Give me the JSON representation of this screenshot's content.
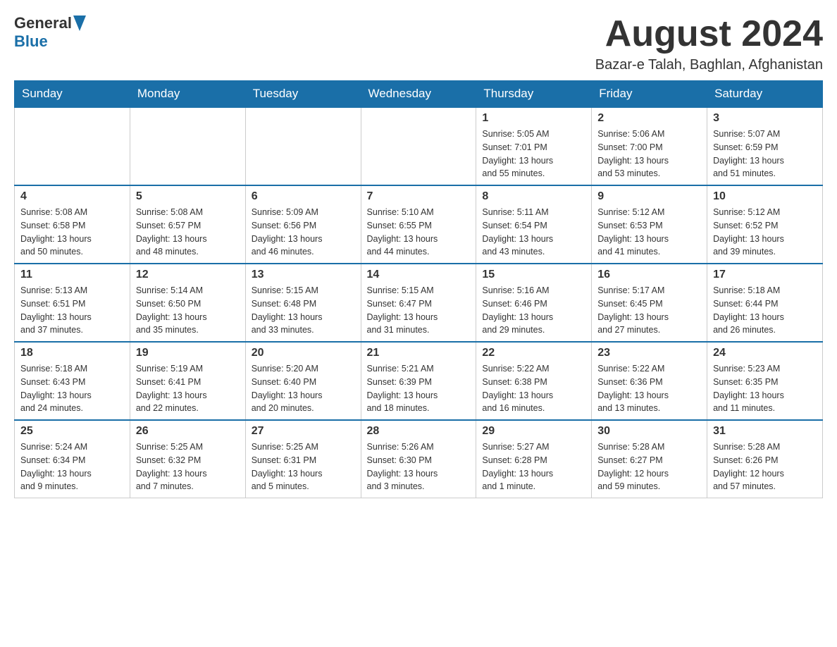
{
  "header": {
    "logo_general": "General",
    "logo_blue": "Blue",
    "month_title": "August 2024",
    "location": "Bazar-e Talah, Baghlan, Afghanistan"
  },
  "days_of_week": [
    "Sunday",
    "Monday",
    "Tuesday",
    "Wednesday",
    "Thursday",
    "Friday",
    "Saturday"
  ],
  "weeks": [
    [
      {
        "day": "",
        "info": ""
      },
      {
        "day": "",
        "info": ""
      },
      {
        "day": "",
        "info": ""
      },
      {
        "day": "",
        "info": ""
      },
      {
        "day": "1",
        "info": "Sunrise: 5:05 AM\nSunset: 7:01 PM\nDaylight: 13 hours\nand 55 minutes."
      },
      {
        "day": "2",
        "info": "Sunrise: 5:06 AM\nSunset: 7:00 PM\nDaylight: 13 hours\nand 53 minutes."
      },
      {
        "day": "3",
        "info": "Sunrise: 5:07 AM\nSunset: 6:59 PM\nDaylight: 13 hours\nand 51 minutes."
      }
    ],
    [
      {
        "day": "4",
        "info": "Sunrise: 5:08 AM\nSunset: 6:58 PM\nDaylight: 13 hours\nand 50 minutes."
      },
      {
        "day": "5",
        "info": "Sunrise: 5:08 AM\nSunset: 6:57 PM\nDaylight: 13 hours\nand 48 minutes."
      },
      {
        "day": "6",
        "info": "Sunrise: 5:09 AM\nSunset: 6:56 PM\nDaylight: 13 hours\nand 46 minutes."
      },
      {
        "day": "7",
        "info": "Sunrise: 5:10 AM\nSunset: 6:55 PM\nDaylight: 13 hours\nand 44 minutes."
      },
      {
        "day": "8",
        "info": "Sunrise: 5:11 AM\nSunset: 6:54 PM\nDaylight: 13 hours\nand 43 minutes."
      },
      {
        "day": "9",
        "info": "Sunrise: 5:12 AM\nSunset: 6:53 PM\nDaylight: 13 hours\nand 41 minutes."
      },
      {
        "day": "10",
        "info": "Sunrise: 5:12 AM\nSunset: 6:52 PM\nDaylight: 13 hours\nand 39 minutes."
      }
    ],
    [
      {
        "day": "11",
        "info": "Sunrise: 5:13 AM\nSunset: 6:51 PM\nDaylight: 13 hours\nand 37 minutes."
      },
      {
        "day": "12",
        "info": "Sunrise: 5:14 AM\nSunset: 6:50 PM\nDaylight: 13 hours\nand 35 minutes."
      },
      {
        "day": "13",
        "info": "Sunrise: 5:15 AM\nSunset: 6:48 PM\nDaylight: 13 hours\nand 33 minutes."
      },
      {
        "day": "14",
        "info": "Sunrise: 5:15 AM\nSunset: 6:47 PM\nDaylight: 13 hours\nand 31 minutes."
      },
      {
        "day": "15",
        "info": "Sunrise: 5:16 AM\nSunset: 6:46 PM\nDaylight: 13 hours\nand 29 minutes."
      },
      {
        "day": "16",
        "info": "Sunrise: 5:17 AM\nSunset: 6:45 PM\nDaylight: 13 hours\nand 27 minutes."
      },
      {
        "day": "17",
        "info": "Sunrise: 5:18 AM\nSunset: 6:44 PM\nDaylight: 13 hours\nand 26 minutes."
      }
    ],
    [
      {
        "day": "18",
        "info": "Sunrise: 5:18 AM\nSunset: 6:43 PM\nDaylight: 13 hours\nand 24 minutes."
      },
      {
        "day": "19",
        "info": "Sunrise: 5:19 AM\nSunset: 6:41 PM\nDaylight: 13 hours\nand 22 minutes."
      },
      {
        "day": "20",
        "info": "Sunrise: 5:20 AM\nSunset: 6:40 PM\nDaylight: 13 hours\nand 20 minutes."
      },
      {
        "day": "21",
        "info": "Sunrise: 5:21 AM\nSunset: 6:39 PM\nDaylight: 13 hours\nand 18 minutes."
      },
      {
        "day": "22",
        "info": "Sunrise: 5:22 AM\nSunset: 6:38 PM\nDaylight: 13 hours\nand 16 minutes."
      },
      {
        "day": "23",
        "info": "Sunrise: 5:22 AM\nSunset: 6:36 PM\nDaylight: 13 hours\nand 13 minutes."
      },
      {
        "day": "24",
        "info": "Sunrise: 5:23 AM\nSunset: 6:35 PM\nDaylight: 13 hours\nand 11 minutes."
      }
    ],
    [
      {
        "day": "25",
        "info": "Sunrise: 5:24 AM\nSunset: 6:34 PM\nDaylight: 13 hours\nand 9 minutes."
      },
      {
        "day": "26",
        "info": "Sunrise: 5:25 AM\nSunset: 6:32 PM\nDaylight: 13 hours\nand 7 minutes."
      },
      {
        "day": "27",
        "info": "Sunrise: 5:25 AM\nSunset: 6:31 PM\nDaylight: 13 hours\nand 5 minutes."
      },
      {
        "day": "28",
        "info": "Sunrise: 5:26 AM\nSunset: 6:30 PM\nDaylight: 13 hours\nand 3 minutes."
      },
      {
        "day": "29",
        "info": "Sunrise: 5:27 AM\nSunset: 6:28 PM\nDaylight: 13 hours\nand 1 minute."
      },
      {
        "day": "30",
        "info": "Sunrise: 5:28 AM\nSunset: 6:27 PM\nDaylight: 12 hours\nand 59 minutes."
      },
      {
        "day": "31",
        "info": "Sunrise: 5:28 AM\nSunset: 6:26 PM\nDaylight: 12 hours\nand 57 minutes."
      }
    ]
  ]
}
